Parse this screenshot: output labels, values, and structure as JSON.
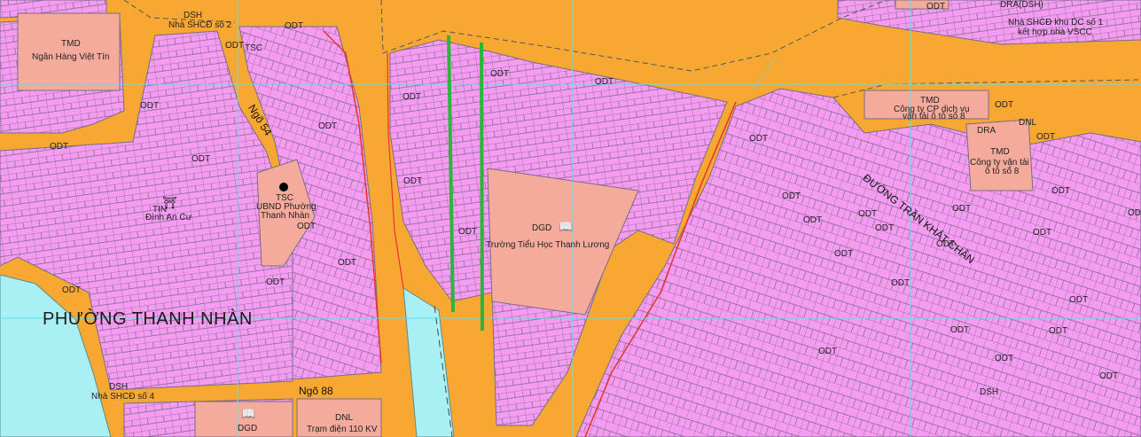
{
  "ward_name": "PHƯỜNG THANH NHÀN",
  "roads": {
    "ngo54": "Ngõ 54",
    "ngo88": "Ngõ 88",
    "tran_khat_chan": "ĐƯỜNG TRẦN KHÁT CHÂN"
  },
  "codes": {
    "odt": "ODT",
    "tmd": "TMD",
    "dsh": "DSH",
    "tsc": "TSC",
    "dgd": "DGD",
    "dnl": "DNL",
    "dra": "DRA",
    "dra_dsh": "DRA(DSH)",
    "tin": "TIN"
  },
  "places": {
    "ngan_hang": "Ngân Hàng Việt Tín",
    "nha_shcd2": "Nhà SHCĐ số 2",
    "nha_shcd4": "Nhà SHCĐ số 4",
    "ubnd_line1": "UBND Phường",
    "ubnd_line2": "Thanh Nhàn",
    "dinh_an_cu": "Đình An Cư",
    "truong": "Trường Tiểu Học Thanh Lương",
    "tram_dien": "Trạm điện 110 KV",
    "nha_shcd_khu1_line1": "Nhà SHCĐ khu DC số 1",
    "nha_shcd_khu1_line2": "kết hợp nhà VSCC",
    "cong_ty_cp_line1": "Công ty CP dịch vụ",
    "cong_ty_cp_line2": "vận tải ô tô số 8",
    "cong_ty_vt_line1": "Công ty vận tải",
    "cong_ty_vt_line2": "ô tô số 8"
  },
  "colors": {
    "road": "#f7a833",
    "residential": "#f59cf2",
    "public": "#f5ab9c",
    "water": "#a9f0f5",
    "parcel_line": "#7a6b86",
    "grid_line": "#66dbe8",
    "highlight_line": "#2bb53b",
    "boundary_red": "#e8332c"
  },
  "icons": {
    "book": "book-icon",
    "temple": "temple-icon",
    "office": "office-dot-icon"
  }
}
